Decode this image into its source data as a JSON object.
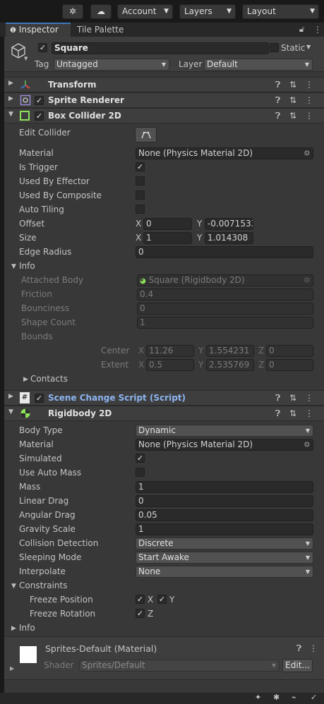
{
  "toolbar": {
    "account": "Account",
    "layers": "Layers",
    "layout": "Layout"
  },
  "tabs": {
    "inspector": "Inspector",
    "tile_palette": "Tile Palette"
  },
  "object": {
    "name": "Square",
    "static_label": "Static",
    "tag_label": "Tag",
    "tag_value": "Untagged",
    "layer_label": "Layer",
    "layer_value": "Default"
  },
  "components": {
    "transform": "Transform",
    "sprite_renderer": "Sprite Renderer",
    "box_collider": "Box Collider 2D",
    "scene_script": "Scene Change Script (Script)",
    "rigidbody": "Rigidbody 2D"
  },
  "box_collider": {
    "edit_collider": "Edit Collider",
    "material_label": "Material",
    "material_value": "None (Physics Material 2D)",
    "is_trigger": "Is Trigger",
    "used_by_effector": "Used By Effector",
    "used_by_composite": "Used By Composite",
    "auto_tiling": "Auto Tiling",
    "offset_label": "Offset",
    "offset_x": "0",
    "offset_y": "-0.0071533",
    "size_label": "Size",
    "size_x": "1",
    "size_y": "1.014308",
    "edge_radius_label": "Edge Radius",
    "edge_radius": "0",
    "info_label": "Info",
    "attached_body_label": "Attached Body",
    "attached_body": "Square (Rigidbody 2D)",
    "friction_label": "Friction",
    "friction": "0.4",
    "bounciness_label": "Bounciness",
    "bounciness": "0",
    "shape_count_label": "Shape Count",
    "shape_count": "1",
    "bounds_label": "Bounds",
    "center_label": "Center",
    "center_x": "11.26",
    "center_y": "1.554231",
    "center_z": "0",
    "extent_label": "Extent",
    "extent_x": "0.5",
    "extent_y": "2.535769",
    "extent_z": "0",
    "contacts_label": "Contacts"
  },
  "axes": {
    "x": "X",
    "y": "Y",
    "z": "Z"
  },
  "rigidbody": {
    "body_type_label": "Body Type",
    "body_type": "Dynamic",
    "material_label": "Material",
    "material_value": "None (Physics Material 2D)",
    "simulated_label": "Simulated",
    "use_auto_mass_label": "Use Auto Mass",
    "mass_label": "Mass",
    "mass": "1",
    "linear_drag_label": "Linear Drag",
    "linear_drag": "0",
    "angular_drag_label": "Angular Drag",
    "angular_drag": "0.05",
    "gravity_scale_label": "Gravity Scale",
    "gravity_scale": "1",
    "collision_detection_label": "Collision Detection",
    "collision_detection": "Discrete",
    "sleeping_mode_label": "Sleeping Mode",
    "sleeping_mode": "Start Awake",
    "interpolate_label": "Interpolate",
    "interpolate": "None",
    "constraints_label": "Constraints",
    "freeze_position_label": "Freeze Position",
    "freeze_rotation_label": "Freeze Rotation",
    "info_label": "Info"
  },
  "material": {
    "name": "Sprites-Default (Material)",
    "shader_label": "Shader",
    "shader_value": "Sprites/Default",
    "edit_button": "Edit..."
  },
  "colors": {
    "accent": "#3a79bb",
    "script_title": "#8cb4f0",
    "collider_icon": "#8ce05a"
  }
}
